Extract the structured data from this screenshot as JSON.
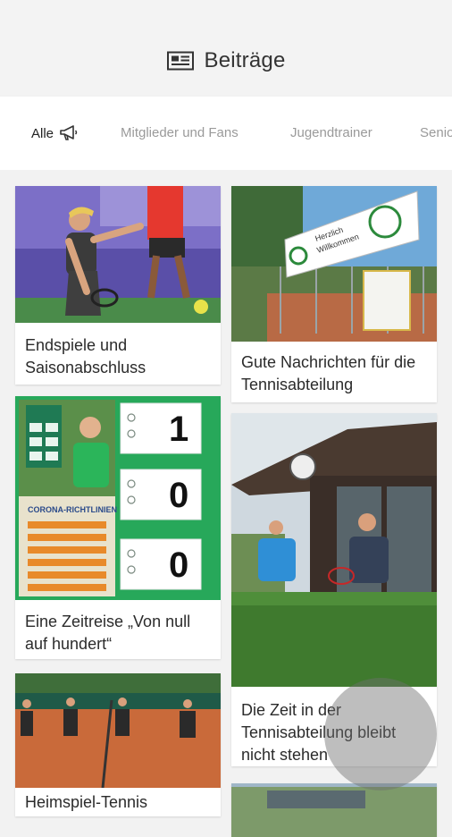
{
  "header": {
    "title": "Beiträge",
    "icon": "newspaper-icon"
  },
  "tabs": [
    {
      "label": "Alle",
      "icon": "megaphone-icon",
      "active": true
    },
    {
      "label": "Mitglieder und Fans",
      "active": false
    },
    {
      "label": "Jugendtrainer",
      "active": false
    },
    {
      "label": "Senio",
      "active": false
    }
  ],
  "posts": [
    {
      "title": "Endspiele und Saisonabschluss"
    },
    {
      "title": "Gute Nachrichten für die Tennisabteilung",
      "sign": {
        "line1": "Herzlich",
        "line2": "Willkommen"
      }
    },
    {
      "title": "Eine Zeitreise „Von null auf hundert“",
      "score_board": {
        "scores": [
          "1",
          "0",
          "0"
        ],
        "sign_title": "CORONA-RICHTLINIEN"
      }
    },
    {
      "title": "Die Zeit in der Tennisabteilung bleibt nicht stehen"
    },
    {
      "title": "Heimspiel-Tennis"
    }
  ],
  "colors": {
    "accent_green": "#27a85a",
    "court_clay": "#c96a3a",
    "sky": "#8ec3e8"
  }
}
